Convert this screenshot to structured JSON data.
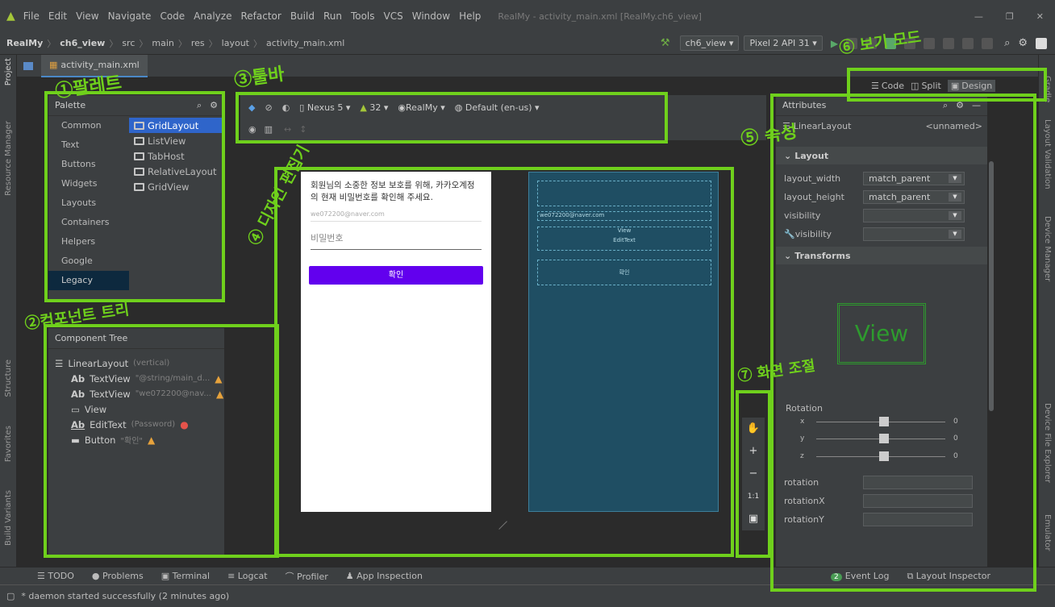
{
  "menu": {
    "items": [
      "File",
      "Edit",
      "View",
      "Navigate",
      "Code",
      "Analyze",
      "Refactor",
      "Build",
      "Run",
      "Tools",
      "VCS",
      "Window",
      "Help"
    ],
    "window_title": "RealMy - activity_main.xml [RealMy.ch6_view]"
  },
  "breadcrumb": [
    "RealMy",
    "ch6_view",
    "src",
    "main",
    "res",
    "layout",
    "activity_main.xml"
  ],
  "toolbar": {
    "run_config": "ch6_view",
    "device": "Pixel 2 API 31"
  },
  "editor_tab": {
    "label": "activity_main.xml"
  },
  "view_modes": {
    "code": "Code",
    "split": "Split",
    "design": "Design"
  },
  "palette": {
    "title": "Palette",
    "categories": [
      "Common",
      "Text",
      "Buttons",
      "Widgets",
      "Layouts",
      "Containers",
      "Helpers",
      "Google",
      "Legacy"
    ],
    "items": [
      "GridLayout",
      "ListView",
      "TabHost",
      "RelativeLayout",
      "GridView"
    ]
  },
  "design_toolbar": {
    "device": "Nexus 5",
    "api": "32",
    "theme": "RealMy",
    "locale": "Default (en-us)"
  },
  "component_tree": {
    "title": "Component Tree",
    "items": [
      {
        "name": "LinearLayout",
        "detail": "(vertical)"
      },
      {
        "name": "TextView",
        "detail": "\"@string/main_d...",
        "status": "warning"
      },
      {
        "name": "TextView",
        "detail": "\"we072200@nav...",
        "status": "warning"
      },
      {
        "name": "View",
        "detail": ""
      },
      {
        "name": "EditText",
        "detail": "(Password)",
        "status": "error"
      },
      {
        "name": "Button",
        "detail": "\"확인\"",
        "status": "warning"
      }
    ]
  },
  "preview": {
    "message": "회원님의 소중한 정보 보호를 위해, 카카오계정의 현재 비밀번호를 확인해 주세요.",
    "email": "we072200@naver.com",
    "password_hint": "비밀번호",
    "button": "확인"
  },
  "blueprint": {
    "view_label": "View",
    "edittext_label": "EditText",
    "button_label": "확인",
    "email": "we072200@naver.com"
  },
  "attributes": {
    "title": "Attributes",
    "component": "LinearLayout",
    "id": "<unnamed>",
    "section_layout": "Layout",
    "rows": [
      {
        "name": "layout_width",
        "value": "match_parent"
      },
      {
        "name": "layout_height",
        "value": "match_parent"
      },
      {
        "name": "visibility",
        "value": ""
      },
      {
        "name": "visibility",
        "value": ""
      }
    ],
    "section_transforms": "Transforms",
    "transform_view": "View",
    "rotation_label": "Rotation",
    "rotation_axes": [
      {
        "axis": "x",
        "value": "0"
      },
      {
        "axis": "y",
        "value": "0"
      },
      {
        "axis": "z",
        "value": "0"
      }
    ],
    "rotation_fields": [
      "rotation",
      "rotationX",
      "rotationY"
    ]
  },
  "zoom": {
    "fit_label": "1:1"
  },
  "bottom_tools": [
    "TODO",
    "Problems",
    "Terminal",
    "Logcat",
    "Profiler",
    "App Inspection"
  ],
  "bottom_right_tools": {
    "event_log": "Event Log",
    "event_count": "2",
    "layout_inspector": "Layout Inspector"
  },
  "status_message": "* daemon started successfully (2 minutes ago)",
  "left_stripe": [
    "Project",
    "Resource Manager",
    "Structure",
    "Favorites",
    "Build Variants"
  ],
  "right_stripe": [
    "Gradle",
    "Layout Validation",
    "Device Manager",
    "Device File Explorer",
    "Emulator"
  ],
  "annotations": {
    "a1": "①팔레트",
    "a2": "②컴포넌트 트리",
    "a3": "③툴바",
    "a4": "④ 디자인 편집기",
    "a5": "⑤ 속성",
    "a6": "⑥ 보기 모드",
    "a7": "⑦ 화면 조절"
  },
  "colors": {
    "annotation": "#6fd01c",
    "accent": "#2f65ca",
    "button": "#6200ee"
  }
}
